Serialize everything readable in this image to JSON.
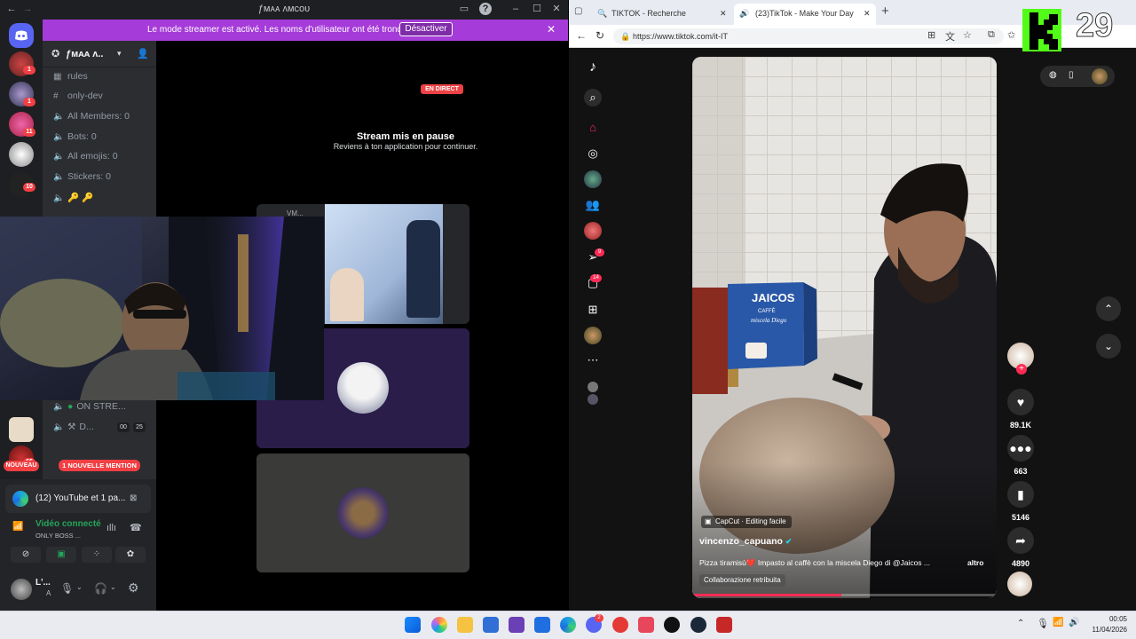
{
  "discord": {
    "window_title": "ƒᴍᴀᴀ ʌᴍᴄᴏᴜ",
    "banner_text": "Le mode streamer est activé. Les noms d'utilisateur ont été tronqués.",
    "banner_button": "Désactiver",
    "server_name": "ƒᴍᴀᴀ ʌ..",
    "server_badges": [
      "1",
      "1",
      "11",
      "10",
      "11"
    ],
    "channels": [
      {
        "icon": "hash",
        "label": "rules"
      },
      {
        "icon": "hash",
        "label": "only-dev"
      },
      {
        "icon": "voice",
        "label": "All Members: 0"
      },
      {
        "icon": "voice",
        "label": "Bots: 0"
      },
      {
        "icon": "voice",
        "label": "All emojis: 0"
      },
      {
        "icon": "voice",
        "label": "Stickers: 0"
      },
      {
        "icon": "voice",
        "label": "🔑 🔑"
      }
    ],
    "voice_rows": [
      {
        "label": "ON STRE..."
      },
      {
        "label": "D..."
      }
    ],
    "voice_counts": [
      "00",
      "25"
    ],
    "live_badge": "EN DIRECT",
    "stream_paused_title": "Stream mis en pause",
    "stream_paused_sub": "Reviens à ton application pour continuer.",
    "stream_tile_label": "VM...",
    "bottom_server_badge": "66",
    "new_badge": "NOUVEAU",
    "mention_badge": "1 NOUVELLE MENTION",
    "activity_title": "(12) YouTube et 1 pa...",
    "voice_connected": "Vidéo connecté",
    "voice_channel": "ONLY BOSS ...",
    "user_name": "L'...",
    "user_status": "A"
  },
  "edge": {
    "tabs": [
      {
        "label": "TIKTOK - Recherche"
      },
      {
        "label": "(23)TikTok - Make Your Day"
      }
    ],
    "url": "https://www.tiktok.com/it-IT"
  },
  "tiktok": {
    "nav_badges": {
      "inbox": "9",
      "messages": "14"
    },
    "actions": {
      "likes": "89.1K",
      "comments": "663",
      "saves": "5146",
      "shares": "4890"
    },
    "capcut_label": "CapCut · Editing facile",
    "author": "vincenzo_capuano",
    "caption": "Pizza tiramisù❤️ Impasto al caffè con la miscela Diego di @Jaicos ...",
    "caption_more": "altro",
    "paid_partnership": "Collaborazione retribuita",
    "product_brand": "JAICOS",
    "product_sub": "CAFFÈ",
    "product_line": "miscela Diego",
    "progress": 0.49
  },
  "overlay": {
    "counter": "29"
  },
  "taskbar": {
    "time": "00:05",
    "date": "11/04/2026",
    "badges": {
      "discord": "2"
    }
  },
  "colors": {
    "discord_bg": "#1e1f22",
    "discord_banner": "#a53bd8",
    "tiktok_red": "#fe2c55",
    "kick_green": "#53fc18"
  }
}
